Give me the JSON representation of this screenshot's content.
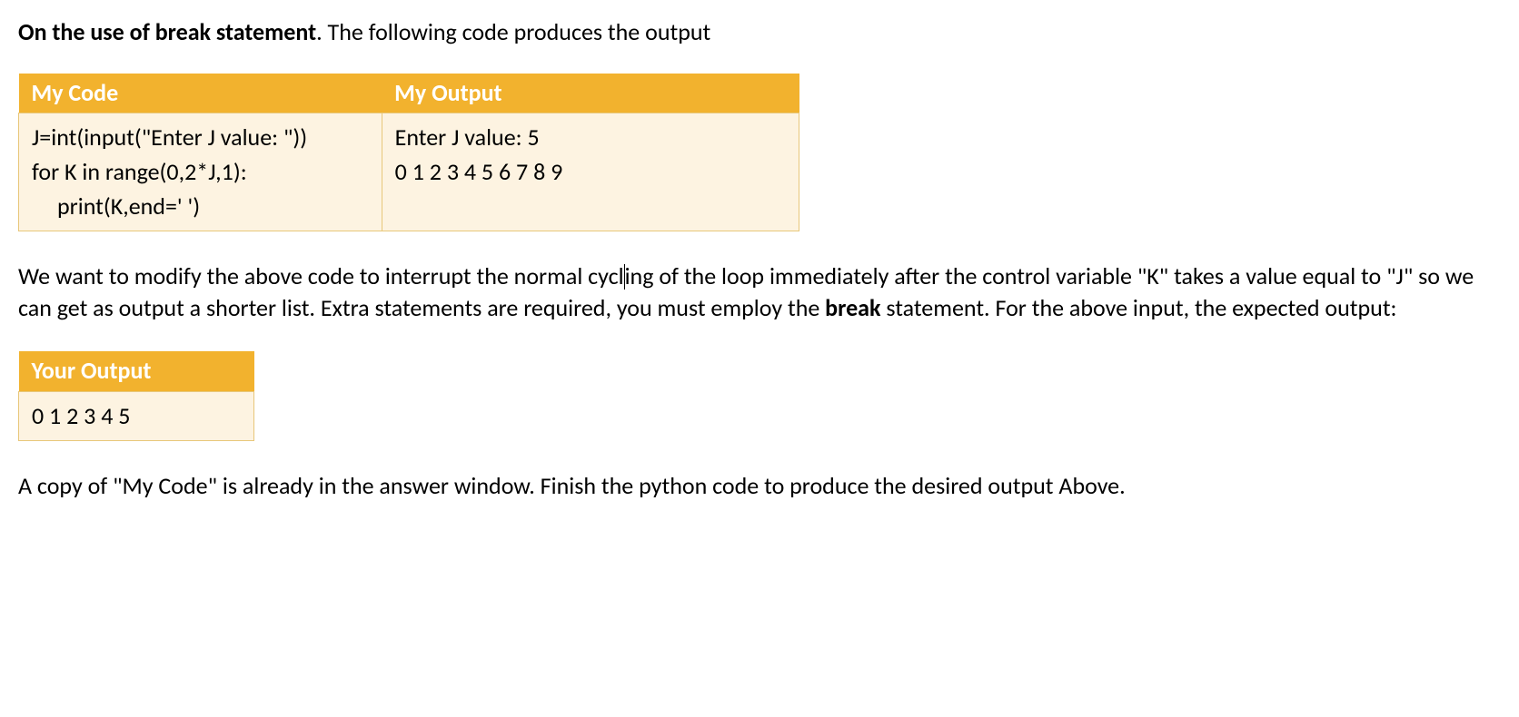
{
  "intro": {
    "bold": "On the use of break statement",
    "rest": ". The following code produces the output"
  },
  "table1": {
    "header_code": "My Code",
    "header_output": "My Output",
    "code_line1": "J=int(input(\"Enter J value: \"))",
    "code_line2": "for K in range(0,2*J,1):",
    "code_line3": "print(K,end=' ')",
    "output_line1": "Enter J value: 5",
    "output_line2": "0 1 2 3 4 5 6 7 8 9"
  },
  "para2": {
    "part1": "We want to modify the above code to interrupt the normal cycl",
    "part2": "ing of the loop immediately after the control variable \"K\" takes a value equal to \"J\" so we can get as output a shorter list. Extra statements are required, you must employ the ",
    "bold": "break",
    "part3": " statement.  For the above input, the expected output:"
  },
  "table2": {
    "header": "Your Output",
    "output": "0 1 2 3 4 5"
  },
  "para3": "A copy of \"My Code\" is already in the answer window. Finish the python code to produce the desired output Above."
}
